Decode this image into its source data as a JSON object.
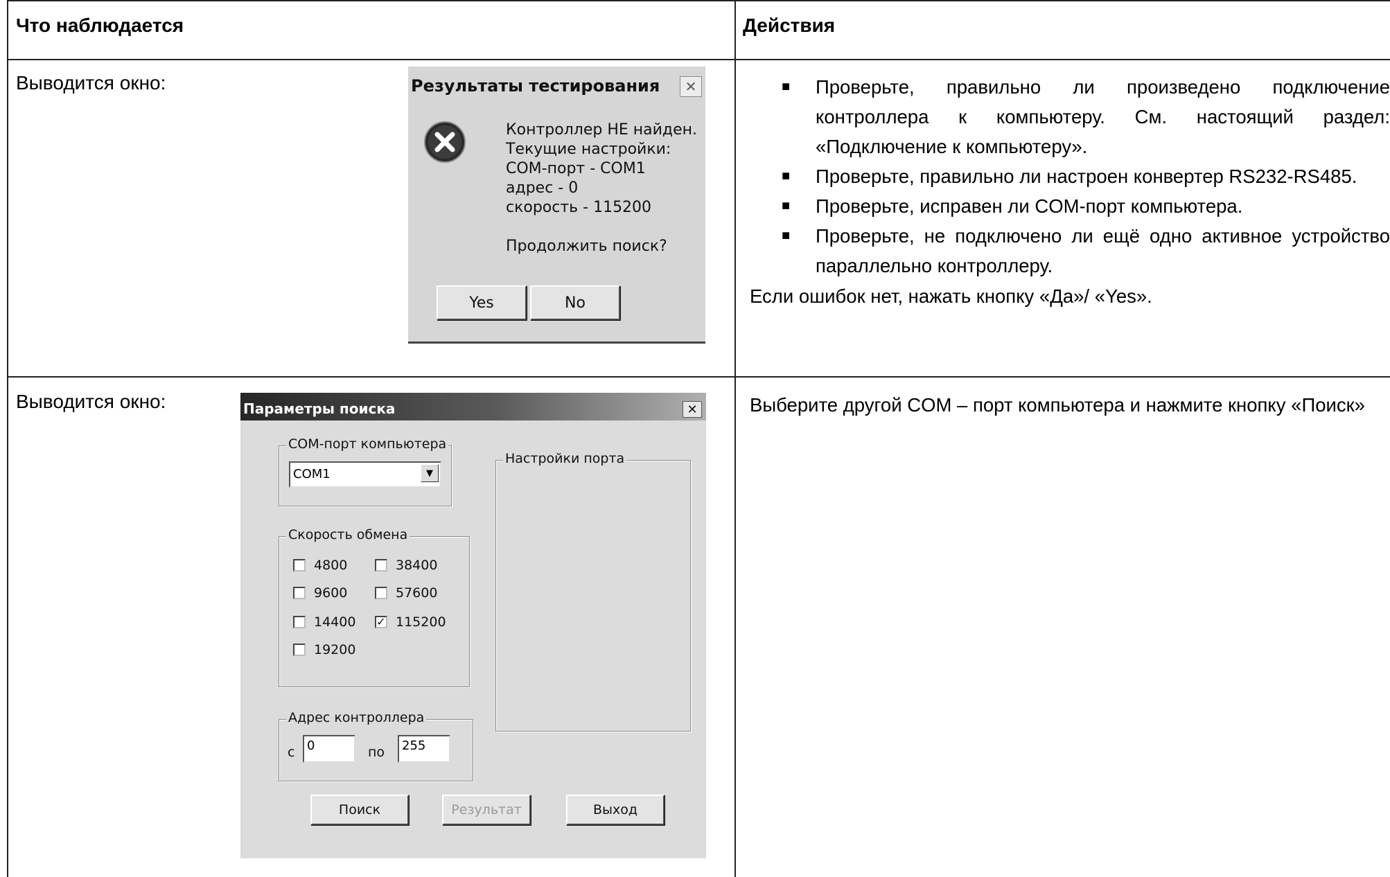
{
  "table": {
    "header_observed": "Что наблюдается",
    "header_actions": "Действия"
  },
  "row1": {
    "observed_text": "Выводится окно:",
    "dialog": {
      "title": "Результаты тестирования",
      "close_glyph": "✕",
      "icon": "error-icon",
      "message_lines": [
        "Контроллер НЕ  найден.",
        "Текущие настройки:",
        "COM-порт - COM1",
        "адрес - 0",
        "скорость - 115200",
        "",
        "Продолжить поиск?"
      ],
      "yes_label": "Yes",
      "no_label": "No"
    },
    "actions": {
      "items": [
        "Проверьте, правильно ли произведено подключение контроллера к компьютеру. См. настоящий раздел: «Подключение к компьютеру».",
        "Проверьте, правильно ли настроен конвертер RS232-RS485.",
        "Проверьте, исправен ли COM-порт компьютера.",
        "Проверьте, не подключено ли ещё одно активное устройство параллельно контроллеру."
      ],
      "after": "Если ошибок нет, нажать кнопку «Да»/ «Yes»."
    }
  },
  "row2": {
    "observed_text": "Выводится окно:",
    "dialog": {
      "title": "Параметры поиска",
      "close_glyph": "✕",
      "com_group_label": "COM-порт компьютера",
      "com_value": "COM1",
      "port_settings_label": "Настройки порта",
      "speed_group_label": "Скорость обмена",
      "speeds": [
        {
          "label": "4800",
          "checked": false
        },
        {
          "label": "38400",
          "checked": false
        },
        {
          "label": "9600",
          "checked": false
        },
        {
          "label": "57600",
          "checked": false
        },
        {
          "label": "14400",
          "checked": false
        },
        {
          "label": "115200",
          "checked": true
        },
        {
          "label": "19200",
          "checked": false
        }
      ],
      "address_group_label": "Адрес контроллера",
      "from_label": "с",
      "from_value": "0",
      "to_label": "по",
      "to_value": "255",
      "search_label": "Поиск",
      "result_label": "Результат",
      "exit_label": "Выход"
    },
    "actions_text": "Выберите другой COM – порт компьютера и нажмите кнопку «Поиск»"
  }
}
